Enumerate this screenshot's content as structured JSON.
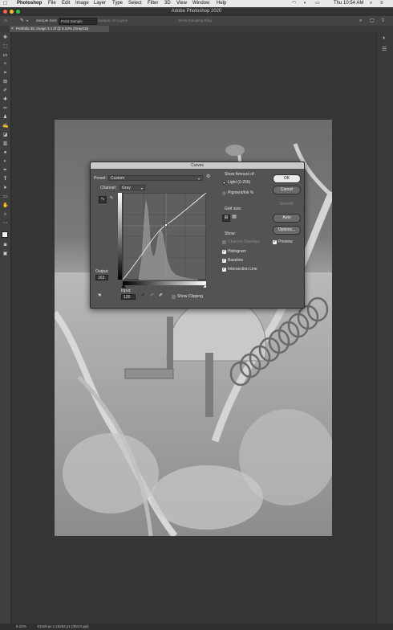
{
  "menubar": {
    "app": "Photoshop",
    "items": [
      "File",
      "Edit",
      "Image",
      "Layer",
      "Type",
      "Select",
      "Filter",
      "3D",
      "View",
      "Window",
      "Help"
    ],
    "clock": "Thu 10:54 AM"
  },
  "window": {
    "title": "Adobe Photoshop 2020"
  },
  "options_bar": {
    "sample_size_label": "Sample Size:",
    "sample_size_value": "Point Sample",
    "sample_scope": "Sample: All Layers",
    "show_ring": "Show Sampling Ring"
  },
  "document_tab": {
    "title": "Portfolio 36, Image 3.1.tif @ 8.33% (Gray/16)"
  },
  "status_bar": {
    "zoom": "8.33%",
    "doc_info": "10169 px x 15254 px (304.8 ppi)"
  },
  "curves_dialog": {
    "title": "Curves",
    "preset_label": "Preset:",
    "preset_value": "Custom",
    "channel_label": "Channel:",
    "channel_value": "Gray",
    "output_label": "Output:",
    "output_value": "163",
    "input_label": "Input:",
    "input_value": "126",
    "show_clipping_label": "Show Clipping",
    "show_amount_label": "Show Amount of:",
    "light_label": "Light  (0-255)",
    "pigment_label": "Pigment/Ink %",
    "grid_size_label": "Grid size:",
    "show_label": "Show:",
    "channel_overlays_label": "Channel Overlays",
    "histogram_label": "Histogram",
    "baseline_label": "Baseline",
    "intersection_label": "Intersection Line",
    "ok_label": "OK",
    "cancel_label": "Cancel",
    "smooth_label": "Smooth",
    "auto_label": "Auto",
    "options_label": "Options...",
    "preview_label": "Preview",
    "checkmark": "✓",
    "checked": {
      "histogram": true,
      "baseline": true,
      "intersection": true,
      "channel_overlays": false,
      "preview": true,
      "show_clipping": false
    },
    "light_selected": true
  }
}
